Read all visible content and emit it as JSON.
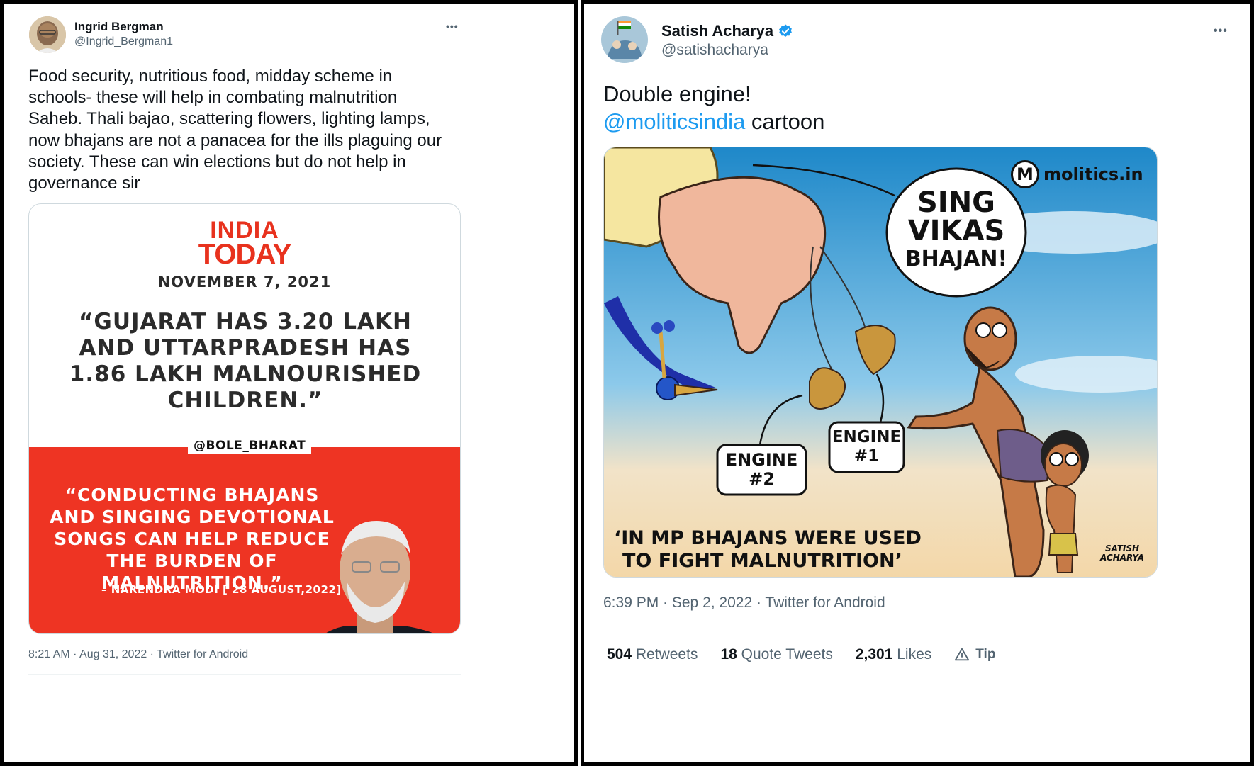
{
  "left_tweet": {
    "author": {
      "name": "Ingrid Bergman",
      "handle": "@Ingrid_Bergman1"
    },
    "more_label": "•••",
    "text_lines": [
      "Food security, nutritious food, midday scheme in",
      "schools- these will help in combating malnutrition",
      "Saheb. Thali bajao, scattering flowers, lighting lamps,",
      "now bhajans are not a panacea for the ills plaguing our",
      "society. These can win elections but do not help in",
      "governance sir"
    ],
    "image": {
      "logo_line1": "INDIA",
      "logo_line2": "TODAY",
      "date": "NOVEMBER 7, 2021",
      "quote1": "“GUJARAT HAS 3.20 LAKH AND UTTARPRADESH HAS 1.86 LAKH MALNOURISHED CHILDREN.”",
      "handle_tag": "@BOLE_BHARAT",
      "quote2": "“CONDUCTING BHAJANS AND SINGING DEVOTIONAL SONGS CAN HELP REDUCE THE BURDEN OF MALNUTRITION.”",
      "attribution": "– NARENDRA MODI [ 28 AUGUST,2022]"
    },
    "meta": "8:21 AM · Aug 31, 2022 · Twitter for Android"
  },
  "right_tweet": {
    "author": {
      "name": "Satish Acharya",
      "handle": "@satishacharya",
      "verified": true
    },
    "more_label": "•••",
    "text_line1": "Double engine!",
    "mention": "@moliticsindia",
    "text_line2_suffix": " cartoon",
    "image": {
      "brand_letter": "M",
      "brand": "molitics.in",
      "bubble_line1": "SING",
      "bubble_line2": "VIKAS",
      "bubble_line3": "BHAJAN!",
      "engine2_line1": "ENGINE",
      "engine2_line2": "#2",
      "engine1_line1": "ENGINE",
      "engine1_line2": "#1",
      "caption_line1": "‘IN MP BHAJANS WERE USED",
      "caption_line2": "TO FIGHT MALNUTRITION’",
      "signature_line1": "SATISH",
      "signature_line2": "ACHARYA"
    },
    "meta": "6:39 PM · Sep 2, 2022 · Twitter for Android",
    "stats": {
      "retweets_count": "504",
      "retweets_label": "Retweets",
      "quotes_count": "18",
      "quotes_label": "Quote Tweets",
      "likes_count": "2,301",
      "likes_label": "Likes",
      "tip_label": "Tip"
    }
  },
  "colors": {
    "link": "#1d9bf0",
    "india_today_red": "#e8321e",
    "poster_red": "#ee3423",
    "verified_blue": "#1d9bf0"
  }
}
